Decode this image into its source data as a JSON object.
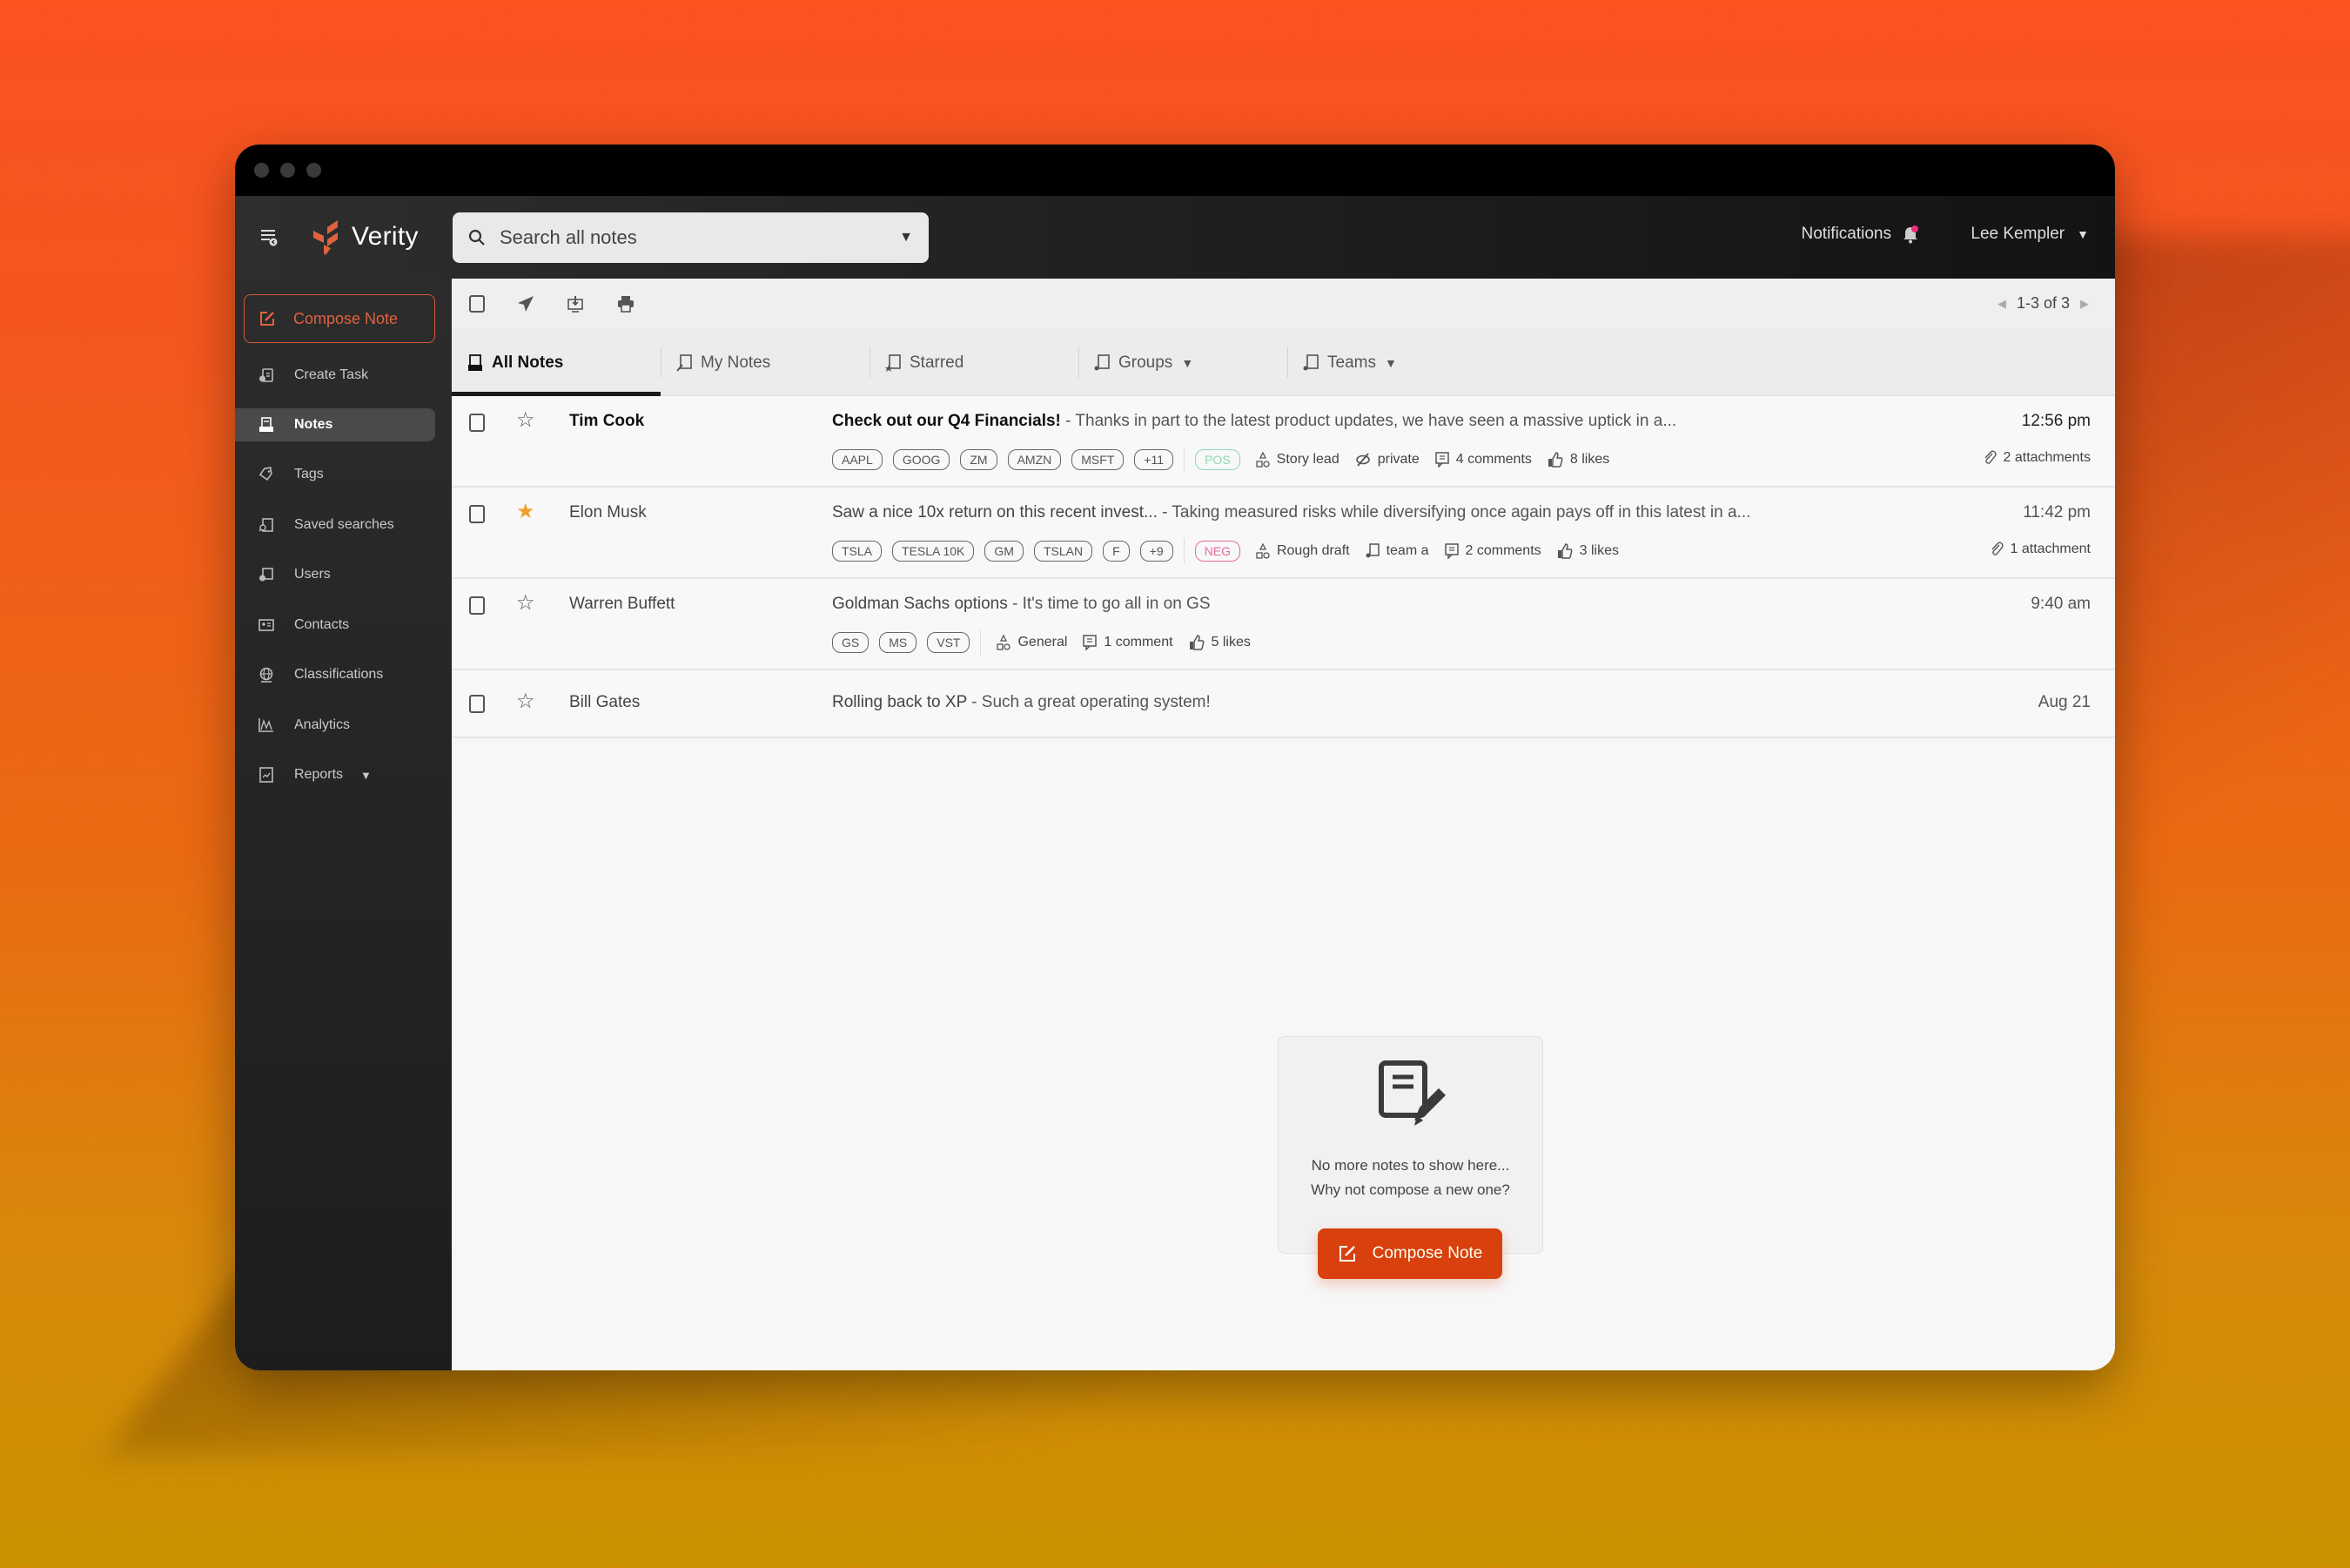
{
  "app": {
    "name": "Verity",
    "accent": "#d8400e"
  },
  "header": {
    "search_placeholder": "Search all notes",
    "notifications_label": "Notifications",
    "user_name": "Lee Kempler"
  },
  "sidebar": {
    "compose_label": "Compose Note",
    "items": [
      {
        "label": "Create Task",
        "icon": "create-task-icon"
      },
      {
        "label": "Notes",
        "icon": "notes-icon",
        "active": true
      },
      {
        "label": "Tags",
        "icon": "tag-icon"
      },
      {
        "label": "Saved searches",
        "icon": "saved-search-icon"
      },
      {
        "label": "Users",
        "icon": "users-icon"
      },
      {
        "label": "Contacts",
        "icon": "contacts-icon"
      },
      {
        "label": "Classifications",
        "icon": "globe-icon"
      },
      {
        "label": "Analytics",
        "icon": "analytics-icon"
      },
      {
        "label": "Reports",
        "icon": "reports-icon",
        "has_dropdown": true
      }
    ]
  },
  "toolbar": {
    "pager": "1-3 of 3"
  },
  "tabs": [
    {
      "label": "All Notes",
      "active": true
    },
    {
      "label": "My Notes"
    },
    {
      "label": "Starred"
    },
    {
      "label": "Groups",
      "dropdown": true
    },
    {
      "label": "Teams",
      "dropdown": true
    }
  ],
  "notes": [
    {
      "sender": "Tim Cook",
      "unread": true,
      "starred": false,
      "subject": "Check out our Q4 Financials!",
      "snippet": " - Thanks in part to the latest product updates, we have seen a massive uptick in a...",
      "time": "12:56 pm",
      "tags": [
        "AAPL",
        "GOOG",
        "ZM",
        "AMZN",
        "MSFT",
        "+11"
      ],
      "sentiment": "POS",
      "category": "Story lead",
      "visibility": "private",
      "comments": "4 comments",
      "likes": "8 likes",
      "attachments": "2 attachments"
    },
    {
      "sender": "Elon Musk",
      "unread": false,
      "starred": true,
      "subject": "Saw a nice 10x return on this recent invest...",
      "snippet": " - Taking measured risks while diversifying once again pays off in this latest in a...",
      "time": "11:42 pm",
      "tags": [
        "TSLA",
        "TESLA 10K",
        "GM",
        "TSLAN",
        "F",
        "+9"
      ],
      "sentiment": "NEG",
      "category": "Rough draft",
      "team": "team a",
      "comments": "2 comments",
      "likes": "3 likes",
      "attachments": "1 attachment"
    },
    {
      "sender": "Warren Buffett",
      "unread": false,
      "starred": false,
      "subject": "Goldman Sachs options",
      "snippet": " - It's time to go all in on GS",
      "time": "9:40 am",
      "tags": [
        "GS",
        "MS",
        "VST"
      ],
      "category": "General",
      "comments": "1 comment",
      "likes": "5 likes"
    },
    {
      "sender": "Bill Gates",
      "unread": false,
      "starred": false,
      "subject": "Rolling back to XP",
      "snippet": " - Such a great operating system!",
      "time": "Aug 21"
    }
  ],
  "empty_state": {
    "line1": "No more notes to show here...",
    "line2": "Why not compose a new one?",
    "button_label": "Compose Note"
  }
}
